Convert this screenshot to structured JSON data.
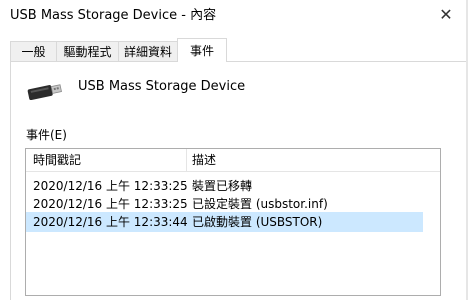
{
  "window": {
    "title": "USB Mass Storage Device - 內容",
    "close_glyph": "✕"
  },
  "tabs": [
    {
      "label": "一般"
    },
    {
      "label": "驅動程式"
    },
    {
      "label": "詳細資料"
    },
    {
      "label": "事件",
      "active": true
    }
  ],
  "device": {
    "icon": "usb-drive-icon",
    "name": "USB Mass Storage Device"
  },
  "events": {
    "label": "事件(E)",
    "columns": [
      "時間戳記",
      "描述"
    ],
    "rows": [
      {
        "time": "2020/12/16 上午 12:33:25",
        "description": "裝置已移轉"
      },
      {
        "time": "2020/12/16 上午 12:33:25",
        "description": "已設定裝置 (usbstor.inf)"
      },
      {
        "time": "2020/12/16 上午 12:33:44",
        "description": "已啟動裝置 (USBSTOR)",
        "selected": true
      }
    ]
  },
  "colors": {
    "selection": "#cce8ff",
    "tab_border": "#d9d9d9",
    "list_border": "#adadad"
  }
}
